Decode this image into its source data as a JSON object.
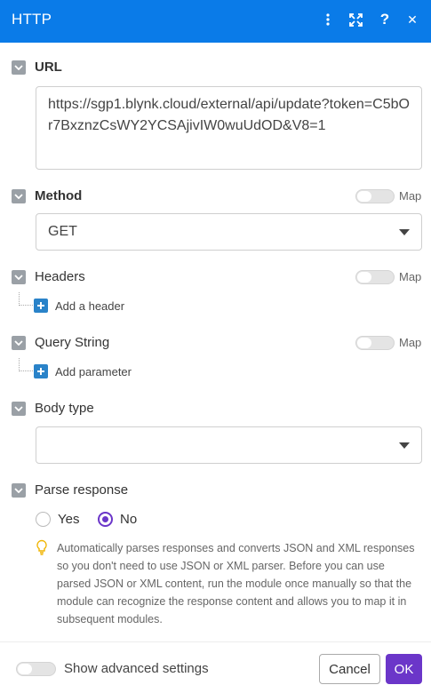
{
  "header": {
    "title": "HTTP",
    "bg_color": "#0a7be8",
    "icons": [
      "more-vertical-icon",
      "expand-icon",
      "help-icon",
      "close-icon"
    ],
    "help_glyph": "?",
    "close_glyph": "✕"
  },
  "url": {
    "label": "URL",
    "value": "https://sgp1.blynk.cloud/external/api/update?token=C5bOr7BxznzCsWY2YCSAjivIW0wuUdOD&V8=1"
  },
  "method": {
    "label": "Method",
    "value": "GET",
    "map_label": "Map"
  },
  "headers": {
    "label": "Headers",
    "map_label": "Map",
    "add_label": "Add a header"
  },
  "query_string": {
    "label": "Query String",
    "map_label": "Map",
    "add_label": "Add parameter"
  },
  "body_type": {
    "label": "Body type",
    "value": ""
  },
  "parse_response": {
    "label": "Parse response",
    "options": [
      "Yes",
      "No"
    ],
    "selected": "No",
    "hint": "Automatically parses responses and converts JSON and XML responses so you don't need to use JSON or XML parser. Before you can use parsed JSON or XML content, run the module once manually so that the module can recognize the response content and allows you to map it in subsequent modules."
  },
  "footer": {
    "advanced_label": "Show advanced settings",
    "cancel_label": "Cancel",
    "ok_label": "OK",
    "accent_color": "#6b36c9"
  }
}
